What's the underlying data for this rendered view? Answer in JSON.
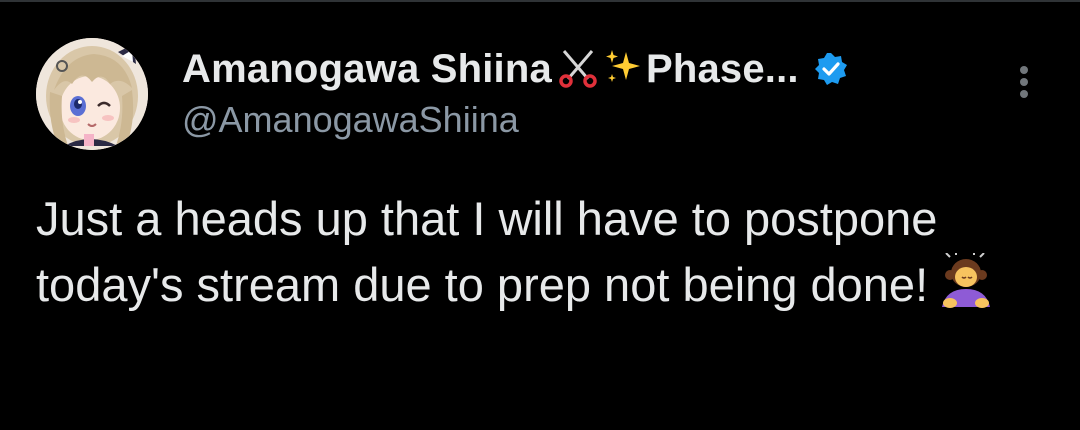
{
  "tweet": {
    "display_name": "Amanogawa Shiina",
    "display_name_suffix": "Phase...",
    "handle": "@AmanogawaShiina",
    "body_text": "Just a heads up that I will have to postpone today's stream due to prep not being done!",
    "icons": {
      "name_icon_1": "scissors-icon",
      "name_icon_2": "sparkles-icon",
      "verified": "verified-badge-icon",
      "more": "more-options-icon",
      "body_emoji": "person-bowing-icon"
    },
    "colors": {
      "background": "#000000",
      "text": "#e7e9ea",
      "secondary_text": "#8b98a5",
      "verified_blue": "#1d9bf0"
    }
  }
}
